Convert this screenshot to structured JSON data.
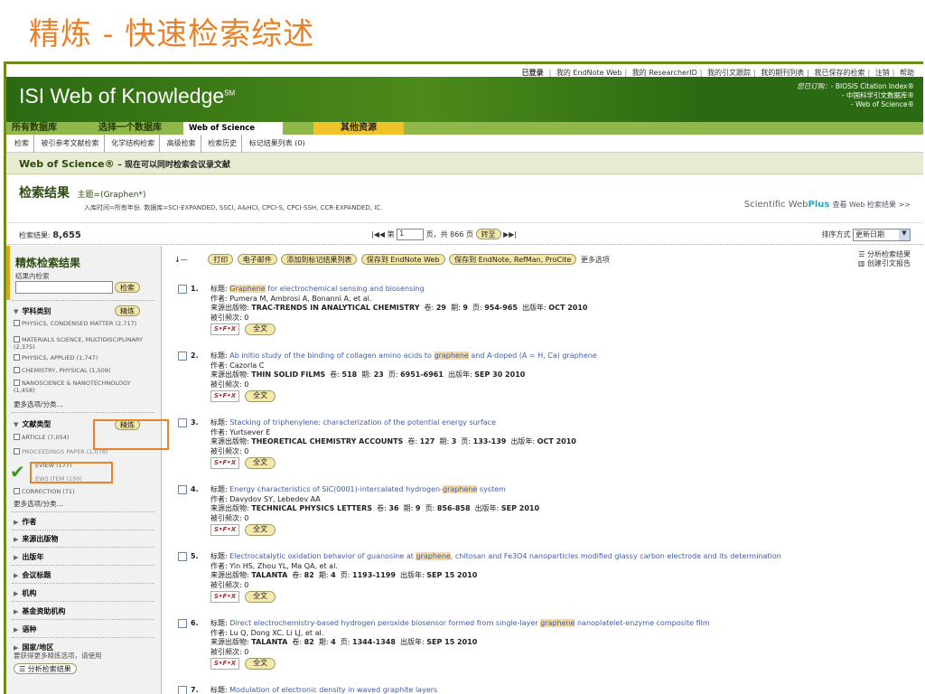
{
  "slide": {
    "title": "精炼 - 快速检索综述"
  },
  "header": {
    "top_links": [
      {
        "label": "已登录",
        "strong": true
      },
      {
        "label": "我的 EndNote Web"
      },
      {
        "label": "我的 ResearcherID"
      },
      {
        "label": "我的引文跟踪"
      },
      {
        "label": "我的期刊列表"
      },
      {
        "label": "我已保存的检索"
      },
      {
        "label": "注销"
      },
      {
        "label": "帮助"
      }
    ],
    "logo": "ISI Web of Knowledge",
    "logo_sm": "SM",
    "subscribed_label": "您已订购：",
    "subscriptions": [
      "- BIOSIS Citation Index®",
      "- 中国科学引文数据库®",
      "- Web of Science®"
    ]
  },
  "tabs": [
    {
      "label": "所有数据库"
    },
    {
      "label": "选择一个数据库"
    },
    {
      "label": "Web of Science",
      "active": true
    },
    {
      "label": "其他资源"
    }
  ],
  "subnav": [
    "检索",
    "被引参考文献检索",
    "化学结构检索",
    "高级检索",
    "检索历史",
    "标记结果列表 (0)"
  ],
  "wos_bar": {
    "title": "Web of Science®",
    "subtitle": "– 现在可以同时检索会议录文献"
  },
  "results_head": {
    "title": "检索结果",
    "topic": "主题=(Graphen*)",
    "db": "入库时间=所有年份. 数据库=SCI-EXPANDED, SSCI, A&HCI, CPCI-S, CPCI-SSH, CCR-EXPANDED, IC.",
    "webplus_a": "Scientific Web",
    "webplus_b": "Plus",
    "webplus_link": "查看 Web 检索结果 >>"
  },
  "countbar": {
    "label": "检索结果:",
    "count": "8,655",
    "page_prefix": "第",
    "page": "1",
    "page_suffix": "页，共 866 页",
    "goto": "转至",
    "sort_label": "排序方式",
    "sort_value": "更新日期"
  },
  "left": {
    "title": "精炼检索结果",
    "search_within": "结果内检索",
    "search_btn": "检索",
    "subject_heading": "学科类别",
    "refine_btn": "精炼",
    "subjects": [
      "PHYSICS, CONDENSED MATTER (2,717)",
      "MATERIALS SCIENCE, MULTIDISCIPLINARY (2,375)",
      "PHYSICS, APPLIED (1,747)",
      "CHEMISTRY, PHYSICAL (1,509)",
      "NANOSCIENCE & NANOTECHNOLOGY (1,458)"
    ],
    "more": "更多选项/分类…",
    "doctype_heading": "文献类型",
    "doctypes": [
      "ARTICLE (7,054)",
      "PROCEEDINGS PAPER (1,078)",
      "EVIEW (177)",
      "EWS ITEM (150)",
      "CORRECTION (71)"
    ],
    "sections": [
      "作者",
      "来源出版物",
      "出版年",
      "会议标题",
      "机构",
      "基金资助机构",
      "语种",
      "国家/地区"
    ],
    "bottom_note": "要获得更多精炼选项，请使用",
    "analyze_btn": "分析检索结果"
  },
  "actions": {
    "buttons": [
      "打印",
      "电子邮件",
      "添加到标记结果列表",
      "保存到 EndNote Web",
      "保存到 EndNote, RefMan, ProCite"
    ],
    "more": "更多选项",
    "analyze": "分析检索结果",
    "citation_report": "创建引文报告"
  },
  "labels": {
    "title": "标题:",
    "author": "作者:",
    "source": "来源出版物:",
    "cited": "被引频次:",
    "vol": "卷:",
    "issue": "期:",
    "pages": "页:",
    "year": "出版年:",
    "sfx": "S•F•X",
    "fulltext": "全文"
  },
  "records": [
    {
      "num": "1.",
      "title_pre": "",
      "hl": "Graphene",
      "title_post": " for electrochemical sensing and biosensing",
      "author": "Pumera M, Ambrosi A, Bonanni A, et al.",
      "source": "TRAC-TRENDS IN ANALYTICAL CHEMISTRY",
      "vol": "29",
      "issue": "9",
      "pages": "954-965",
      "year": "OCT 2010",
      "cited": "0"
    },
    {
      "num": "2.",
      "title_pre": "Ab initio study of the binding of collagen amino acids to ",
      "hl": "graphene",
      "title_post": " and A-doped (A = H, Ca) graphene",
      "author": "Cazorla C",
      "source": "THIN SOLID FILMS",
      "vol": "518",
      "issue": "23",
      "pages": "6951-6961",
      "year": "SEP 30 2010",
      "cited": "0"
    },
    {
      "num": "3.",
      "title_pre": "Stacking of triphenylene: characterization of the potential energy surface",
      "hl": "",
      "title_post": "",
      "author": "Yurtsever E",
      "source": "THEORETICAL CHEMISTRY ACCOUNTS",
      "vol": "127",
      "issue": "3",
      "pages": "133-139",
      "year": "OCT 2010",
      "cited": "0"
    },
    {
      "num": "4.",
      "title_pre": "Energy characteristics of SiC(0001)-intercalated hydrogen-",
      "hl": "graphene",
      "title_post": " system",
      "author": "Davydov SY, Lebedev AA",
      "source": "TECHNICAL PHYSICS LETTERS",
      "vol": "36",
      "issue": "9",
      "pages": "856-858",
      "year": "SEP 2010",
      "cited": "0"
    },
    {
      "num": "5.",
      "title_pre": "Electrocatalytic oxidation behavior of guanosine at ",
      "hl": "graphene",
      "title_post": ", chitosan and Fe3O4 nanoparticles modified glassy carbon electrode and its determination",
      "author": "Yin HS, Zhou YL, Ma QA, et al.",
      "source": "TALANTA",
      "vol": "82",
      "issue": "4",
      "pages": "1193-1199",
      "year": "SEP 15 2010",
      "cited": "0"
    },
    {
      "num": "6.",
      "title_pre": "Direct electrochemistry-based hydrogen peroxide biosensor formed from single-layer ",
      "hl": "graphene",
      "title_post": " nanoplatelet-enzyme composite film",
      "author": "Lu Q, Dong XC, Li LJ, et al.",
      "source": "TALANTA",
      "vol": "82",
      "issue": "4",
      "pages": "1344-1348",
      "year": "SEP 15 2010",
      "cited": "0"
    },
    {
      "num": "7.",
      "title_pre": "Modulation of electronic density in waved graphite layers",
      "hl": "",
      "title_post": "",
      "author": "",
      "source": "",
      "vol": "",
      "issue": "",
      "pages": "",
      "year": "",
      "cited": ""
    }
  ]
}
